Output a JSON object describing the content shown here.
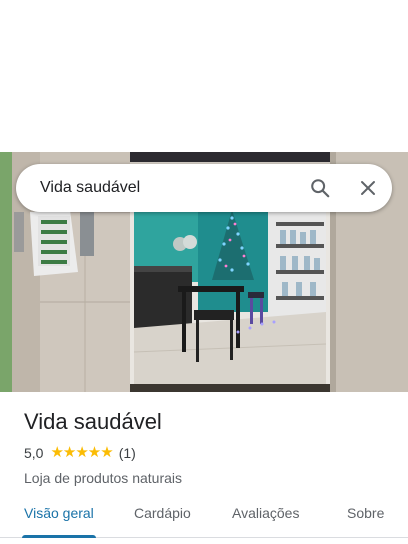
{
  "search": {
    "query": "Vida saudável",
    "search_icon": "search-icon",
    "close_icon": "close-icon"
  },
  "photo": {
    "description_icon": "store-photo"
  },
  "place": {
    "name": "Vida saudável",
    "rating": "5,0",
    "stars": "★★★★★",
    "review_count": "(1)",
    "category": "Loja de produtos naturais"
  },
  "tabs": [
    {
      "label": "Visão geral",
      "active": true
    },
    {
      "label": "Cardápio",
      "active": false
    },
    {
      "label": "Avaliações",
      "active": false
    },
    {
      "label": "Sobre",
      "active": false
    }
  ],
  "colors": {
    "accent": "#1a73a8",
    "star": "#fbbc04",
    "text": "#202124",
    "secondary_text": "#5f6368"
  }
}
